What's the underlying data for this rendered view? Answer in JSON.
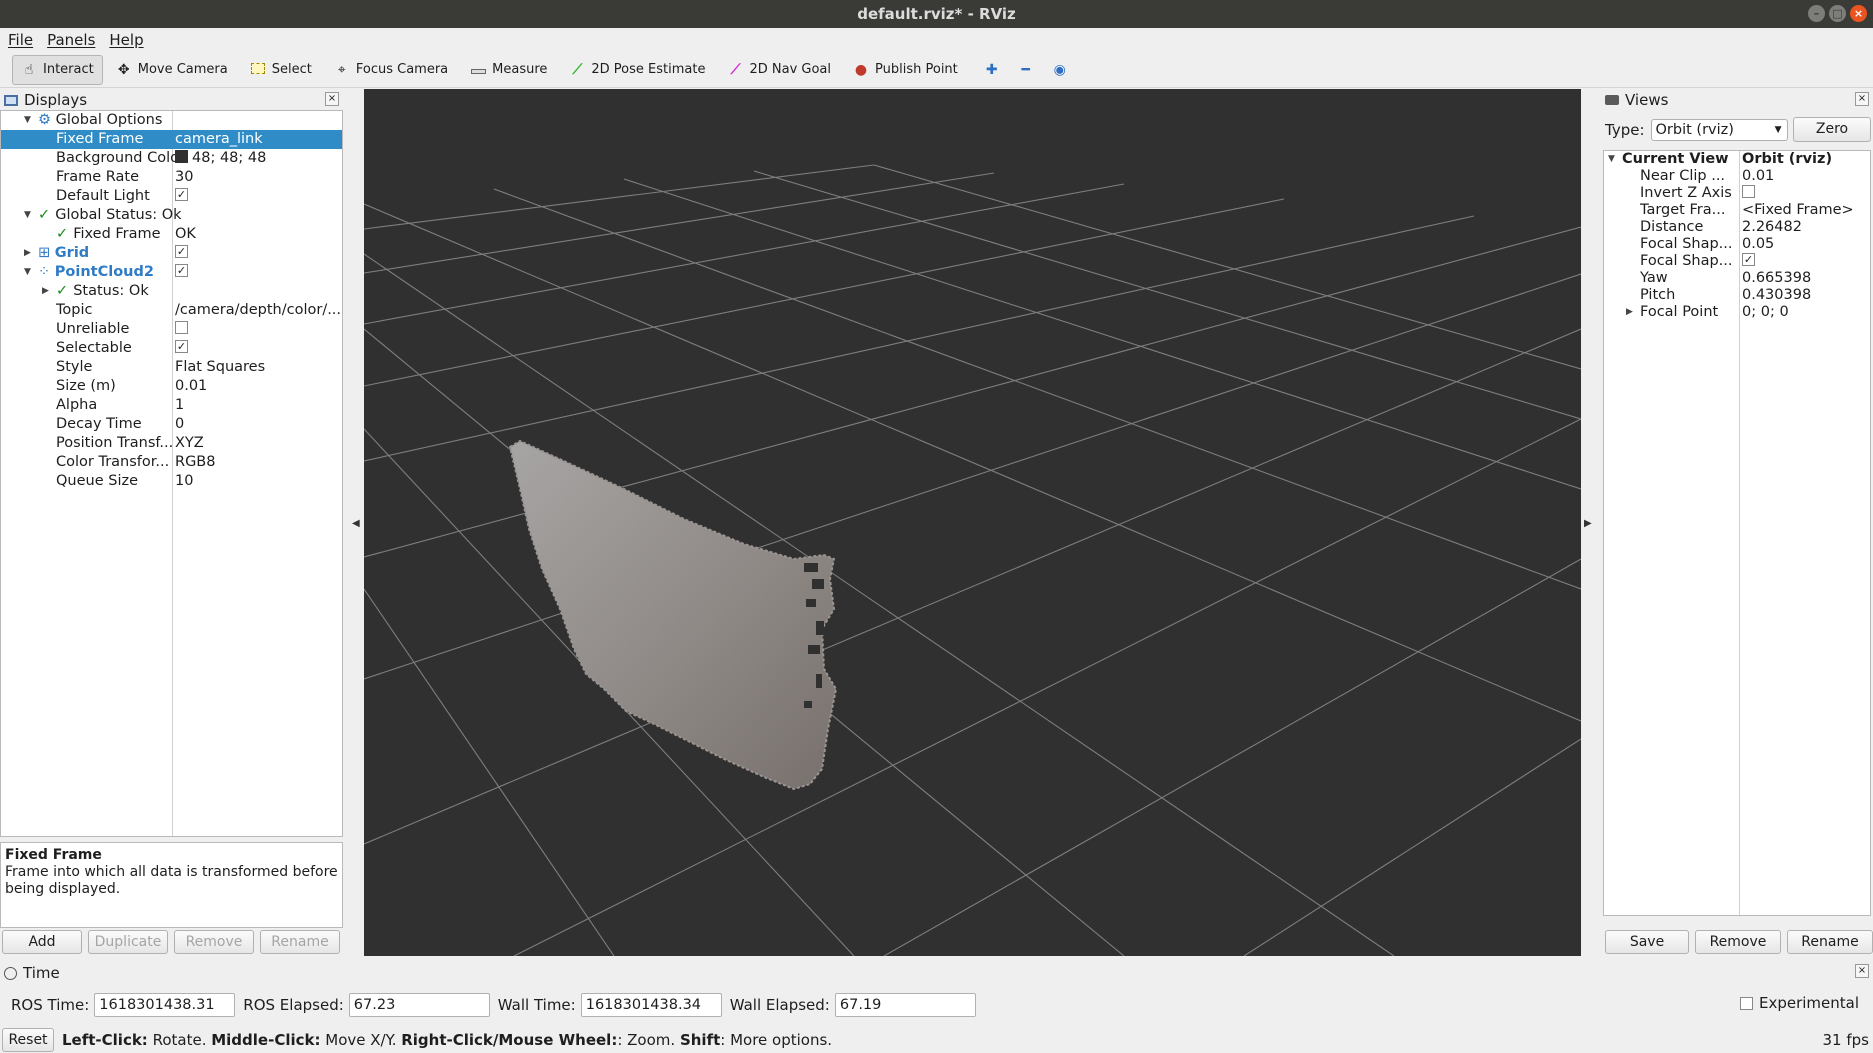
{
  "window": {
    "title": "default.rviz* - RViz"
  },
  "menu": [
    "File",
    "Panels",
    "Help"
  ],
  "toolbar": {
    "tools": [
      {
        "label": "Interact",
        "icon": "hand-cursor-icon",
        "active": true
      },
      {
        "label": "Move Camera",
        "icon": "move-camera-icon"
      },
      {
        "label": "Select",
        "icon": "select-rect-icon"
      },
      {
        "label": "Focus Camera",
        "icon": "focus-camera-icon"
      },
      {
        "label": "Measure",
        "icon": "ruler-icon"
      },
      {
        "label": "2D Pose Estimate",
        "icon": "green-arrow-icon"
      },
      {
        "label": "2D Nav Goal",
        "icon": "magenta-arrow-icon"
      },
      {
        "label": "Publish Point",
        "icon": "map-pin-icon"
      }
    ]
  },
  "displays": {
    "title": "Displays",
    "rows": [
      {
        "key": "Global Options",
        "level": 0,
        "expand": "open",
        "icon": "gear-icon"
      },
      {
        "key": "Fixed Frame",
        "value": "camera_link",
        "level": 1,
        "selected": true
      },
      {
        "key": "Background Color",
        "value": "48; 48; 48",
        "level": 1,
        "swatch": "#303030"
      },
      {
        "key": "Frame Rate",
        "value": "30",
        "level": 1
      },
      {
        "key": "Default Light",
        "check": true,
        "level": 1
      },
      {
        "key": "Global Status: Ok",
        "level": 0,
        "expand": "open",
        "ok": true
      },
      {
        "key": "Fixed Frame",
        "value": "OK",
        "level": 1,
        "ok": true
      },
      {
        "key": "Grid",
        "level": 0,
        "expand": "closed",
        "icon": "grid-icon",
        "check": true,
        "blue": true
      },
      {
        "key": "PointCloud2",
        "level": 0,
        "expand": "open",
        "icon": "pointcloud-icon",
        "check": true,
        "blue": true
      },
      {
        "key": "Status: Ok",
        "level": 1,
        "expand": "closed",
        "ok": true
      },
      {
        "key": "Topic",
        "value": "/camera/depth/color/...",
        "level": 1
      },
      {
        "key": "Unreliable",
        "check": false,
        "level": 1
      },
      {
        "key": "Selectable",
        "check": true,
        "level": 1
      },
      {
        "key": "Style",
        "value": "Flat Squares",
        "level": 1
      },
      {
        "key": "Size (m)",
        "value": "0.01",
        "level": 1
      },
      {
        "key": "Alpha",
        "value": "1",
        "level": 1
      },
      {
        "key": "Decay Time",
        "value": "0",
        "level": 1
      },
      {
        "key": "Position Transf...",
        "value": "XYZ",
        "level": 1
      },
      {
        "key": "Color Transfor...",
        "value": "RGB8",
        "level": 1
      },
      {
        "key": "Queue Size",
        "value": "10",
        "level": 1
      }
    ],
    "description": {
      "title": "Fixed Frame",
      "text": "Frame into which all data is transformed before being displayed."
    },
    "buttons": [
      {
        "label": "Add",
        "enabled": true
      },
      {
        "label": "Duplicate",
        "enabled": false
      },
      {
        "label": "Remove",
        "enabled": false
      },
      {
        "label": "Rename",
        "enabled": false
      }
    ]
  },
  "views": {
    "title": "Views",
    "type_label": "Type:",
    "type_value": "Orbit (rviz)",
    "zero_label": "Zero",
    "rows": [
      {
        "key": "Current View",
        "value": "Orbit (rviz)",
        "level": 0,
        "expand": "open",
        "bold": true
      },
      {
        "key": "Near Clip ...",
        "value": "0.01",
        "level": 1
      },
      {
        "key": "Invert Z Axis",
        "check": false,
        "level": 1
      },
      {
        "key": "Target Fra...",
        "value": "<Fixed Frame>",
        "level": 1
      },
      {
        "key": "Distance",
        "value": "2.26482",
        "level": 1
      },
      {
        "key": "Focal Shap...",
        "value": "0.05",
        "level": 1
      },
      {
        "key": "Focal Shap...",
        "check": true,
        "level": 1
      },
      {
        "key": "Yaw",
        "value": "0.665398",
        "level": 1
      },
      {
        "key": "Pitch",
        "value": "0.430398",
        "level": 1
      },
      {
        "key": "Focal Point",
        "value": "0; 0; 0",
        "level": 1,
        "expand": "closed"
      }
    ],
    "buttons": [
      "Save",
      "Remove",
      "Rename"
    ]
  },
  "time": {
    "title": "Time",
    "ros_time_label": "ROS Time:",
    "ros_time": "1618301438.31",
    "ros_elapsed_label": "ROS Elapsed:",
    "ros_elapsed": "67.23",
    "wall_time_label": "Wall Time:",
    "wall_time": "1618301438.34",
    "wall_elapsed_label": "Wall Elapsed:",
    "wall_elapsed": "67.19",
    "experimental_label": "Experimental"
  },
  "status": {
    "reset_label": "Reset",
    "hint": [
      {
        "b": "Left-Click:",
        "t": " Rotate. "
      },
      {
        "b": "Middle-Click:",
        "t": " Move X/Y. "
      },
      {
        "b": "Right-Click/Mouse Wheel:",
        "t": ": Zoom. "
      },
      {
        "b": "Shift",
        "t": ": More options."
      }
    ],
    "fps": "31 fps"
  },
  "colors": {
    "viewport_bg": "#303030",
    "selection": "#308cc6",
    "accent_close": "#e95420"
  }
}
